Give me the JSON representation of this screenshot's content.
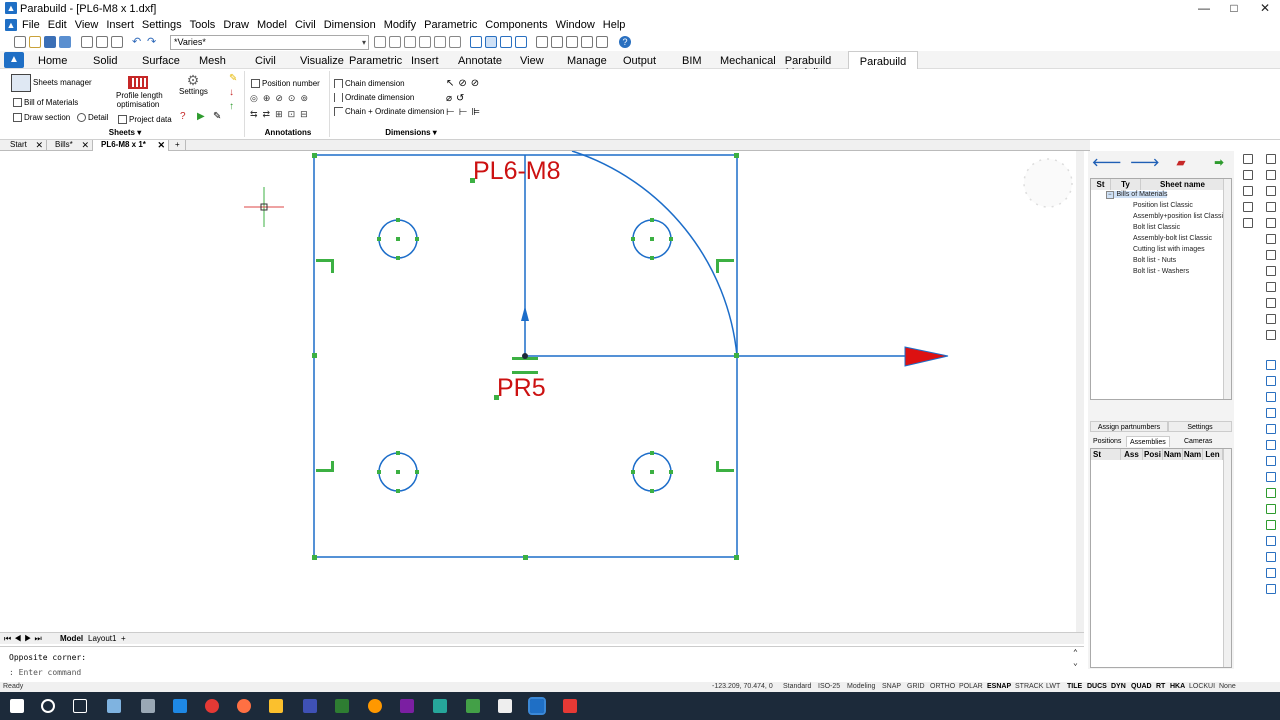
{
  "window": {
    "app_name": "Parabuild",
    "title": "Parabuild - [PL6-M8 x 1.dxf]",
    "controls": [
      "—",
      "□",
      "✕"
    ]
  },
  "menubar": {
    "items": [
      "File",
      "Edit",
      "View",
      "Insert",
      "Settings",
      "Tools",
      "Draw",
      "Model",
      "Civil",
      "Dimension",
      "Modify",
      "Parametric",
      "Components",
      "Window",
      "Help"
    ]
  },
  "qat": {
    "combo_value": "*Varies*"
  },
  "ribbon_tabs": {
    "items": [
      "Home",
      "Solid",
      "Surface",
      "Mesh",
      "Civil",
      "Visualize",
      "Parametric",
      "Insert",
      "Annotate",
      "View",
      "Manage",
      "Output",
      "BIM",
      "Mechanical",
      "Parabuild Modeling",
      "Parabuild Output"
    ],
    "active": "Parabuild Output"
  },
  "ribbon": {
    "sheets_manager": "Sheets manager",
    "bill_of_materials": "Bill of Materials",
    "draw_section": "Draw section",
    "detail": "Detail",
    "profile_length": "Profile length",
    "optimisation": "optimisation",
    "project_data": "Project data",
    "settings": "Settings",
    "group_sheets": "Sheets",
    "position_number": "Position number",
    "group_annotations": "Annotations",
    "chain_dimension": "Chain dimension",
    "ordinate_dimension": "Ordinate dimension",
    "chain_ordinate_dimension": "Chain + Ordinate dimension",
    "group_dimensions": "Dimensions"
  },
  "doc_tabs": {
    "items": [
      "Start",
      "Bills*",
      "PL6-M8 x 1*"
    ],
    "active_index": 2,
    "add": "+"
  },
  "drawing": {
    "part_label": "PL6-M8",
    "position_label": "PR5",
    "colors": {
      "geometry": "#1c6dc9",
      "text": "#cc1111",
      "grip": "#3cb043",
      "arrow": "#dd1111"
    }
  },
  "layout_tabs": {
    "items": [
      "Model",
      "Layout1"
    ],
    "active": "Model",
    "add": "+"
  },
  "command": {
    "history": "Opposite corner:",
    "prompt": ": Enter command"
  },
  "status": {
    "ready": "Ready",
    "coords": "-123.209, 70.474, 0",
    "items": [
      "Standard",
      "ISO-25",
      "Modeling",
      "SNAP",
      "GRID",
      "ORTHO",
      "POLAR",
      "ESNAP",
      "STRACK",
      "LWT",
      "TILE",
      "DUCS",
      "DYN",
      "QUAD",
      "RT",
      "HKA",
      "LOCKUI",
      "None"
    ],
    "active": [
      "ESNAP",
      "TILE",
      "DUCS",
      "DYN",
      "QUAD",
      "RT",
      "HKA"
    ]
  },
  "right_panel": {
    "tree_headers": [
      "St",
      "Ty",
      "Sheet name"
    ],
    "root": "Bills of Materials",
    "children": [
      "Position list Classic",
      "Assembly+position list Classic",
      "Bolt list Classic",
      "Assembly-bolt list Classic",
      "Cutting list with images",
      "Bolt list - Nuts",
      "Bolt list - Washers"
    ],
    "assign_partnumbers": "Assign partnumbers",
    "settings": "Settings",
    "tabs": [
      "Positions",
      "Assemblies",
      "Cameras"
    ],
    "active_tab": "Assemblies",
    "grid_headers": [
      "St",
      "Ass",
      "Posi",
      "Nam",
      "Nam",
      "Len"
    ]
  }
}
